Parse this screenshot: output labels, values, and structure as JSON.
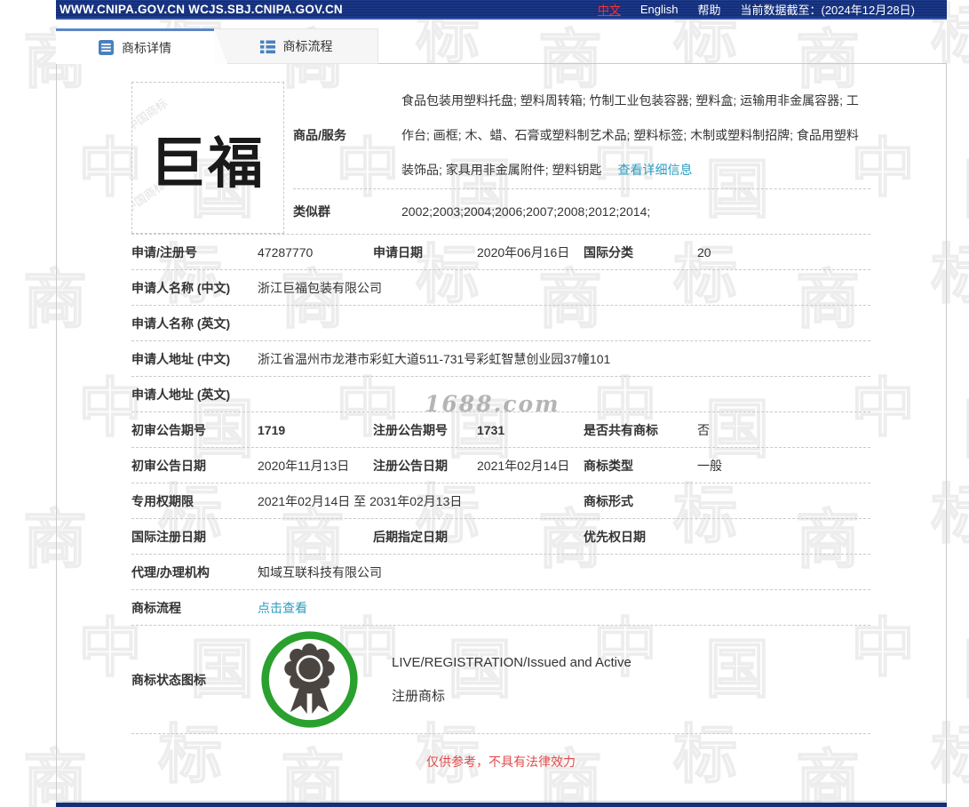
{
  "topbar": {
    "urls": "WWW.CNIPA.GOV.CN WCJS.SBJ.CNIPA.GOV.CN",
    "lang_zh": "中文",
    "lang_en": "English",
    "help": "帮助",
    "cutoff": "当前数据截至：(2024年12月28日)"
  },
  "tabs": {
    "detail": "商标详情",
    "process": "商标流程"
  },
  "mark": {
    "image_text": "巨福"
  },
  "fields": {
    "goods": {
      "label": "商品/服务",
      "value": "食品包装用塑料托盘; 塑料周转箱; 竹制工业包装容器; 塑料盒; 运输用非金属容器; 工作台; 画框; 木、蜡、石膏或塑料制艺术品; 塑料标签; 木制或塑料制招牌; 食品用塑料装饰品; 家具用非金属附件; 塑料钥匙",
      "link": "查看详细信息"
    },
    "similar_group": {
      "label": "类似群",
      "value": "2002;2003;2004;2006;2007;2008;2012;2014;"
    },
    "reg_no": {
      "label": "申请/注册号",
      "value": "47287770"
    },
    "app_date": {
      "label": "申请日期",
      "value": "2020年06月16日"
    },
    "intl_class": {
      "label": "国际分类",
      "value": "20"
    },
    "applicant_cn": {
      "label": "申请人名称 (中文)",
      "value": "浙江巨福包装有限公司"
    },
    "applicant_en": {
      "label": "申请人名称 (英文)",
      "value": ""
    },
    "addr_cn": {
      "label": "申请人地址 (中文)",
      "value": "浙江省温州市龙港市彩虹大道511-731号彩虹智慧创业园37幢101"
    },
    "addr_en": {
      "label": "申请人地址 (英文)",
      "value": ""
    },
    "first_pub_no": {
      "label": "初审公告期号",
      "value": "1719"
    },
    "reg_pub_no": {
      "label": "注册公告期号",
      "value": "1731"
    },
    "is_shared": {
      "label": "是否共有商标",
      "value": "否"
    },
    "first_pub_date": {
      "label": "初审公告日期",
      "value": "2020年11月13日"
    },
    "reg_pub_date": {
      "label": "注册公告日期",
      "value": "2021年02月14日"
    },
    "mark_type": {
      "label": "商标类型",
      "value": "一般"
    },
    "term": {
      "label": "专用权期限",
      "value": "2021年02月14日 至 2031年02月13日"
    },
    "mark_form": {
      "label": "商标形式",
      "value": ""
    },
    "intl_reg_date": {
      "label": "国际注册日期",
      "value": ""
    },
    "late_desig_date": {
      "label": "后期指定日期",
      "value": ""
    },
    "priority_date": {
      "label": "优先权日期",
      "value": ""
    },
    "agency": {
      "label": "代理/办理机构",
      "value": "知域互联科技有限公司"
    },
    "process": {
      "label": "商标流程",
      "link": "点击查看"
    },
    "status": {
      "label": "商标状态图标",
      "line1": "LIVE/REGISTRATION/Issued and Active",
      "line2": "注册商标"
    }
  },
  "disclaimer": "仅供参考，不具有法律效力",
  "watermarks": {
    "site": "1688.com",
    "brand": "中国商标",
    "chars": [
      "商",
      "标",
      "中",
      "国"
    ]
  },
  "colors": {
    "navy": "#142e78",
    "accent_blue": "#4a80c0",
    "tab_border_blue": "#5b87c6",
    "link_teal": "#2b9bbf",
    "status_green": "#2aa12e",
    "lang_red": "#ff2d2d",
    "disclaimer_red": "#e24c4c"
  }
}
